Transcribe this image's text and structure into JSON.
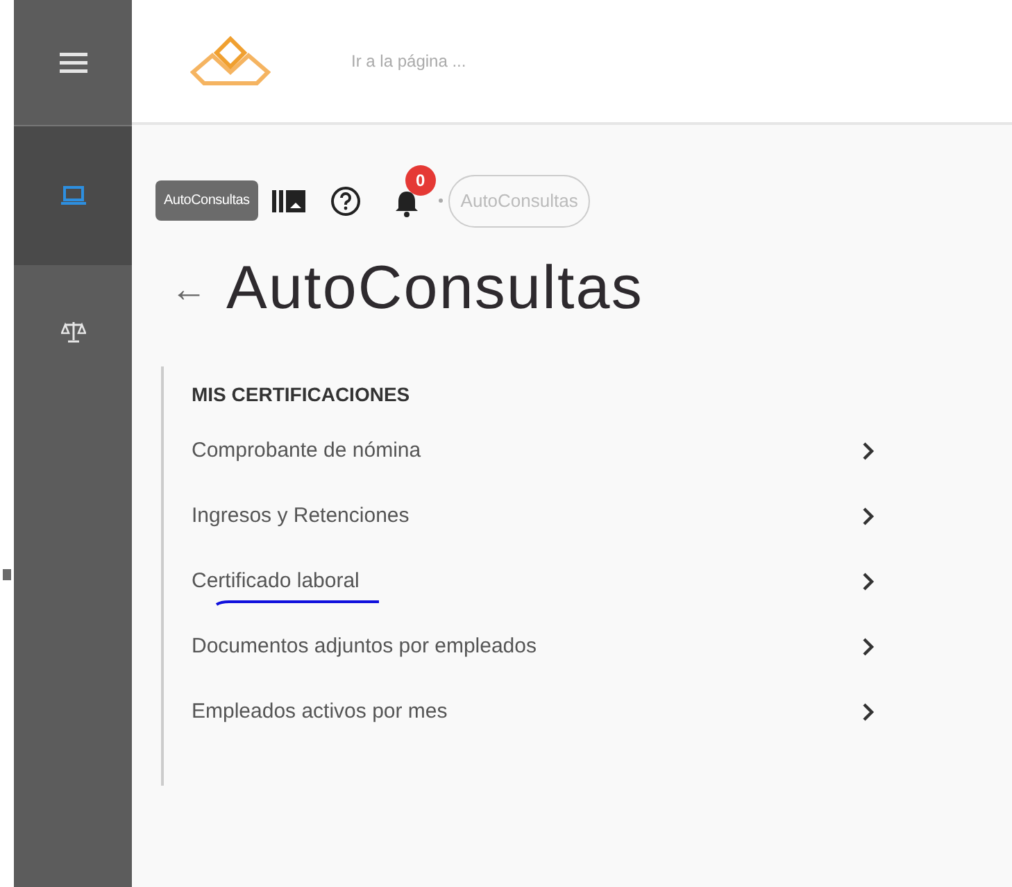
{
  "sidebar": {
    "items": [
      {
        "kind": "laptop",
        "selected": true
      },
      {
        "kind": "scale",
        "selected": false
      }
    ]
  },
  "top_bar": {
    "search": {
      "placeholder": "Ir a la página ..."
    }
  },
  "toolbar": {
    "tag": "AutoConsultas",
    "notifications": "0",
    "breadcrumb": "AutoConsultas"
  },
  "page": {
    "back": "←",
    "title": "AutoConsultas"
  },
  "section": {
    "heading": "MIS CERTIFICACIONES",
    "items": [
      {
        "label": "Comprobante de nómina",
        "underlined": false
      },
      {
        "label": "Ingresos y Retenciones",
        "underlined": false
      },
      {
        "label": "Certificado laboral",
        "underlined": true
      },
      {
        "label": "Documentos adjuntos por empleados",
        "underlined": false
      },
      {
        "label": "Empleados activos por mes",
        "underlined": false
      }
    ]
  }
}
